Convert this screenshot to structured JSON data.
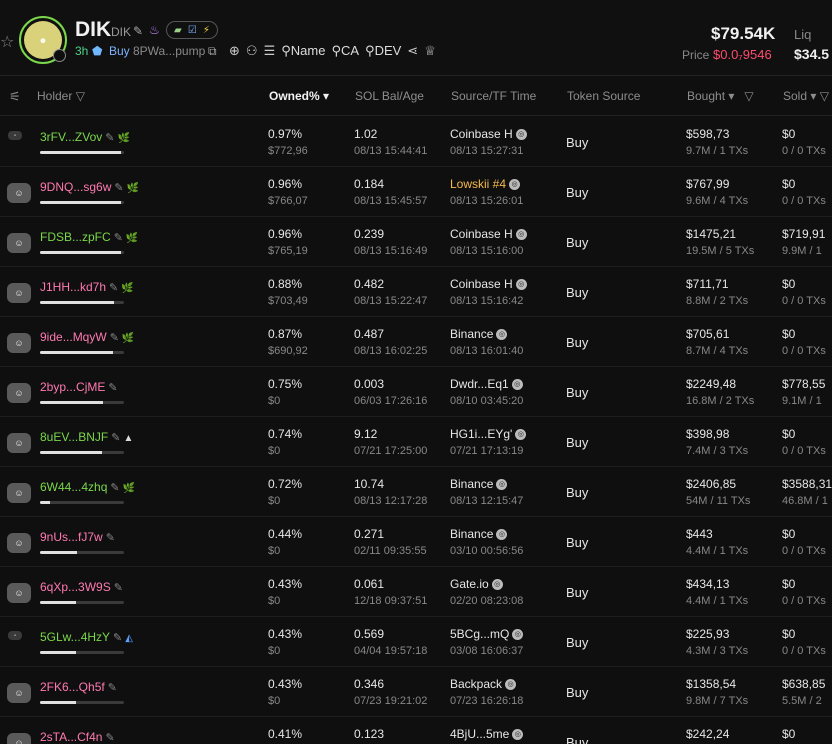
{
  "token": {
    "name": "DIK",
    "symbol": "DIK",
    "age": "3h",
    "buy_tag": "Buy",
    "address": "8PWa...pump",
    "market_cap": "$79.54K",
    "liq_label": "Liq",
    "liq_value": "$34.5",
    "price_label": "Price",
    "price_value": "$0.0₇9546",
    "search_name": "Name",
    "search_ca": "CA",
    "search_dev": "DEV"
  },
  "columns": {
    "holder": "Holder",
    "owned": "Owned%",
    "sol_bal": "SOL Bal/Age",
    "source": "Source/TF Time",
    "token_source": "Token Source",
    "bought": "Bought",
    "sold": "Sold"
  },
  "rows": [
    {
      "holder": "3rFV...ZVov",
      "color": "#7bd84a",
      "tag": "leaf",
      "avatar": "small",
      "pct": "0.97%",
      "val": "$772,96",
      "bar": 0.97,
      "sol": "1.02",
      "sol_time": "08/13 15:44:41",
      "src": "Coinbase H",
      "src_time": "08/13 15:27:31",
      "src_color": "#e6e6e6",
      "tsrc": "Buy",
      "bought": "$598,73",
      "bought_sub": "9.7M / 1 TXs",
      "sold": "$0",
      "sold_sub": "0 / 0 TXs"
    },
    {
      "holder": "9DNQ...sg6w",
      "color": "#ff7ab0",
      "tag": "leaf",
      "avatar": "ape",
      "pct": "0.96%",
      "val": "$766,07",
      "bar": 0.96,
      "sol": "0.184",
      "sol_time": "08/13 15:45:57",
      "src": "Lowskii #4",
      "src_time": "08/13 15:26:01",
      "src_color": "#f5b84a",
      "tsrc": "Buy",
      "bought": "$767,99",
      "bought_sub": "9.6M / 4 TXs",
      "sold": "$0",
      "sold_sub": "0 / 0 TXs"
    },
    {
      "holder": "FDSB...zpFC",
      "color": "#7bd84a",
      "tag": "leaf",
      "avatar": "ape",
      "pct": "0.96%",
      "val": "$765,19",
      "bar": 0.96,
      "sol": "0.239",
      "sol_time": "08/13 15:16:49",
      "src": "Coinbase H",
      "src_time": "08/13 15:16:00",
      "src_color": "#e6e6e6",
      "tsrc": "Buy",
      "bought": "$1475,21",
      "bought_sub": "19.5M / 5 TXs",
      "sold": "$719,91",
      "sold_sub": "9.9M / 1"
    },
    {
      "holder": "J1HH...kd7h",
      "color": "#ff7ab0",
      "tag": "leaf",
      "avatar": "ape",
      "pct": "0.88%",
      "val": "$703,49",
      "bar": 0.88,
      "sol": "0.482",
      "sol_time": "08/13 15:22:47",
      "src": "Coinbase H",
      "src_time": "08/13 15:16:42",
      "src_color": "#e6e6e6",
      "tsrc": "Buy",
      "bought": "$711,71",
      "bought_sub": "8.8M / 2 TXs",
      "sold": "$0",
      "sold_sub": "0 / 0 TXs"
    },
    {
      "holder": "9ide...MqyW",
      "color": "#ff7ab0",
      "tag": "leaf",
      "avatar": "ape",
      "pct": "0.87%",
      "val": "$690,92",
      "bar": 0.87,
      "sol": "0.487",
      "sol_time": "08/13 16:02:25",
      "src": "Binance",
      "src_time": "08/13 16:01:40",
      "src_color": "#e6e6e6",
      "tsrc": "Buy",
      "bought": "$705,61",
      "bought_sub": "8.7M / 4 TXs",
      "sold": "$0",
      "sold_sub": "0 / 0 TXs"
    },
    {
      "holder": "2byp...CjME",
      "color": "#ff7ab0",
      "tag": "",
      "avatar": "ape",
      "pct": "0.75%",
      "val": "$0",
      "bar": 0.75,
      "sol": "0.003",
      "sol_time": "06/03 17:26:16",
      "src": "Dwdr...Eq1",
      "src_time": "08/10 03:45:20",
      "src_color": "#e6e6e6",
      "tsrc": "Buy",
      "bought": "$2249,48",
      "bought_sub": "16.8M / 2 TXs",
      "sold": "$778,55",
      "sold_sub": "9.1M / 1"
    },
    {
      "holder": "8uEV...BNJF",
      "color": "#7bd84a",
      "tag": "up",
      "avatar": "ape",
      "pct": "0.74%",
      "val": "$0",
      "bar": 0.74,
      "sol": "9.12",
      "sol_time": "07/21 17:25:00",
      "src": "HG1i...EYg'",
      "src_time": "07/21 17:13:19",
      "src_color": "#e6e6e6",
      "tsrc": "Buy",
      "bought": "$398,98",
      "bought_sub": "7.4M / 3 TXs",
      "sold": "$0",
      "sold_sub": "0 / 0 TXs"
    },
    {
      "holder": "6W44...4zhq",
      "color": "#7bd84a",
      "tag": "leaf",
      "avatar": "ape",
      "pct": "0.72%",
      "val": "$0",
      "bar": 0.12,
      "sol": "10.74",
      "sol_time": "08/13 12:17:28",
      "src": "Binance",
      "src_time": "08/13 12:15:47",
      "src_color": "#e6e6e6",
      "tsrc": "Buy",
      "bought": "$2406,85",
      "bought_sub": "54M / 11 TXs",
      "sold": "$3588,31",
      "sold_sub": "46.8M / 1"
    },
    {
      "holder": "9nUs...fJ7w",
      "color": "#ff7ab0",
      "tag": "",
      "avatar": "ape",
      "pct": "0.44%",
      "val": "$0",
      "bar": 0.44,
      "sol": "0.271",
      "sol_time": "02/11 09:35:55",
      "src": "Binance",
      "src_time": "03/10 00:56:56",
      "src_color": "#e6e6e6",
      "tsrc": "Buy",
      "bought": "$443",
      "bought_sub": "4.4M / 1 TXs",
      "sold": "$0",
      "sold_sub": "0 / 0 TXs"
    },
    {
      "holder": "6qXp...3W9S",
      "color": "#ff7ab0",
      "tag": "",
      "avatar": "ape",
      "pct": "0.43%",
      "val": "$0",
      "bar": 0.43,
      "sol": "0.061",
      "sol_time": "12/18 09:37:51",
      "src": "Gate.io",
      "src_time": "02/20 08:23:08",
      "src_color": "#e6e6e6",
      "tsrc": "Buy",
      "bought": "$434,13",
      "bought_sub": "4.4M / 1 TXs",
      "sold": "$0",
      "sold_sub": "0 / 0 TXs"
    },
    {
      "holder": "5GLw...4HzY",
      "color": "#7bd84a",
      "tag": "fish",
      "avatar": "small",
      "pct": "0.43%",
      "val": "$0",
      "bar": 0.43,
      "sol": "0.569",
      "sol_time": "04/04 19:57:18",
      "src": "5BCg...mQ",
      "src_time": "03/08 16:06:37",
      "src_color": "#e6e6e6",
      "tsrc": "Buy",
      "bought": "$225,93",
      "bought_sub": "4.3M / 3 TXs",
      "sold": "$0",
      "sold_sub": "0 / 0 TXs"
    },
    {
      "holder": "2FK6...Qh5f",
      "color": "#ff7ab0",
      "tag": "",
      "avatar": "ape",
      "pct": "0.43%",
      "val": "$0",
      "bar": 0.43,
      "sol": "0.346",
      "sol_time": "07/23 19:21:02",
      "src": "Backpack",
      "src_time": "07/23 16:26:18",
      "src_color": "#e6e6e6",
      "tsrc": "Buy",
      "bought": "$1358,54",
      "bought_sub": "9.8M / 7 TXs",
      "sold": "$638,85",
      "sold_sub": "5.5M / 2"
    },
    {
      "holder": "2sTA...Cf4n",
      "color": "#ff7ab0",
      "tag": "",
      "avatar": "ape",
      "pct": "0.41%",
      "val": "",
      "bar": 0.41,
      "sol": "0.123",
      "sol_time": "",
      "src": "4BjU...5me",
      "src_time": "",
      "src_color": "#e6e6e6",
      "tsrc": "Buy",
      "bought": "$242,24",
      "bought_sub": "",
      "sold": "$0",
      "sold_sub": ""
    }
  ]
}
